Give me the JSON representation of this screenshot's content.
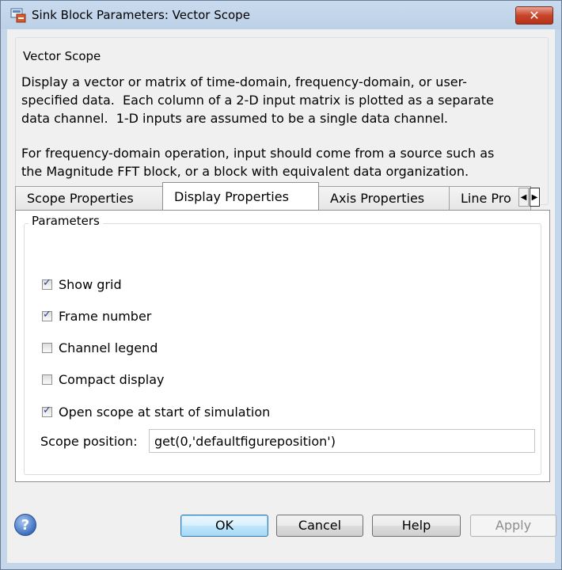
{
  "window": {
    "title": "Sink Block Parameters: Vector Scope",
    "close_label": "✕"
  },
  "block_group": {
    "legend": "Vector Scope",
    "description_1": "Display a vector or matrix of time-domain, frequency-domain, or user-\nspecified data.  Each column of a 2-D input matrix is plotted as a separate\ndata channel.  1-D inputs are assumed to be a single data channel.",
    "description_2": "For frequency-domain operation, input should come from a source such as\nthe Magnitude FFT block, or a block with equivalent data organization."
  },
  "tabs": [
    {
      "label": "Scope Properties",
      "active": false
    },
    {
      "label": "Display Properties",
      "active": true
    },
    {
      "label": "Axis Properties",
      "active": false
    },
    {
      "label": "Line Pro",
      "active": false
    }
  ],
  "tab_scroll": {
    "left": "◀",
    "right": "▶"
  },
  "parameters": {
    "legend": "Parameters",
    "options": [
      {
        "label": "Show grid",
        "checked": true
      },
      {
        "label": "Frame number",
        "checked": true
      },
      {
        "label": "Channel legend",
        "checked": false
      },
      {
        "label": "Compact display",
        "checked": false
      },
      {
        "label": "Open scope at start of simulation",
        "checked": true
      }
    ],
    "scope_position_label": "Scope position:",
    "scope_position_value": "get(0,'defaultfigureposition')"
  },
  "buttons": {
    "ok": "OK",
    "cancel": "Cancel",
    "help": "Help",
    "apply": "Apply"
  },
  "help_icon_glyph": "?"
}
